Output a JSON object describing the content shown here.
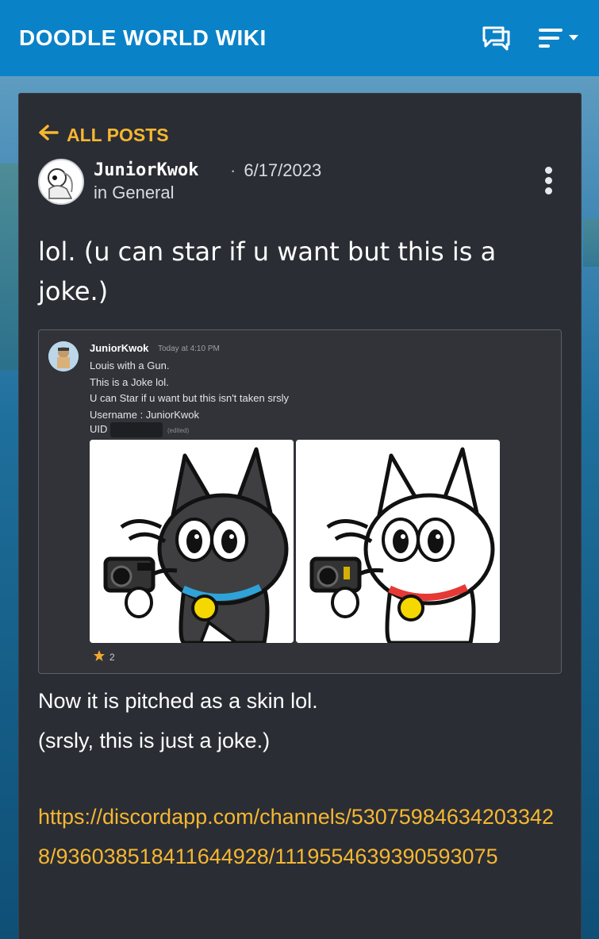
{
  "header": {
    "site_title": "DOODLE WORLD WIKI",
    "chat_icon": "chat-bubbles-icon",
    "menu_icon": "hamburger-menu-icon",
    "bg_color": "#0a82c8"
  },
  "post": {
    "back_label": "ALL POSTS",
    "author": "JuniorKwok",
    "date": "6/17/2023",
    "category": "in General",
    "title": "lol. (u can star if u want but this is a joke.)",
    "body_line_1": "Now it is pitched as a skin lol.",
    "body_line_2": "(srsly, this is just a joke.)",
    "link": "https://discordapp.com/channels/530759846342033428/936038518411644928/1119554639390593075",
    "accent_color": "#f5b731"
  },
  "embed": {
    "author": "JuniorKwok",
    "time": "Today at 4:10 PM",
    "lines": [
      "Louis with a Gun.",
      "This is a Joke lol.",
      "U can Star if u want but this isn't taken srsly",
      "Username : JuniorKwok"
    ],
    "uid_label": "UID",
    "edited_label": "(edited)",
    "reaction_icon": "star-icon",
    "reaction_count": "2",
    "images": [
      "black-cat-with-camera",
      "white-cat-with-camera"
    ]
  }
}
